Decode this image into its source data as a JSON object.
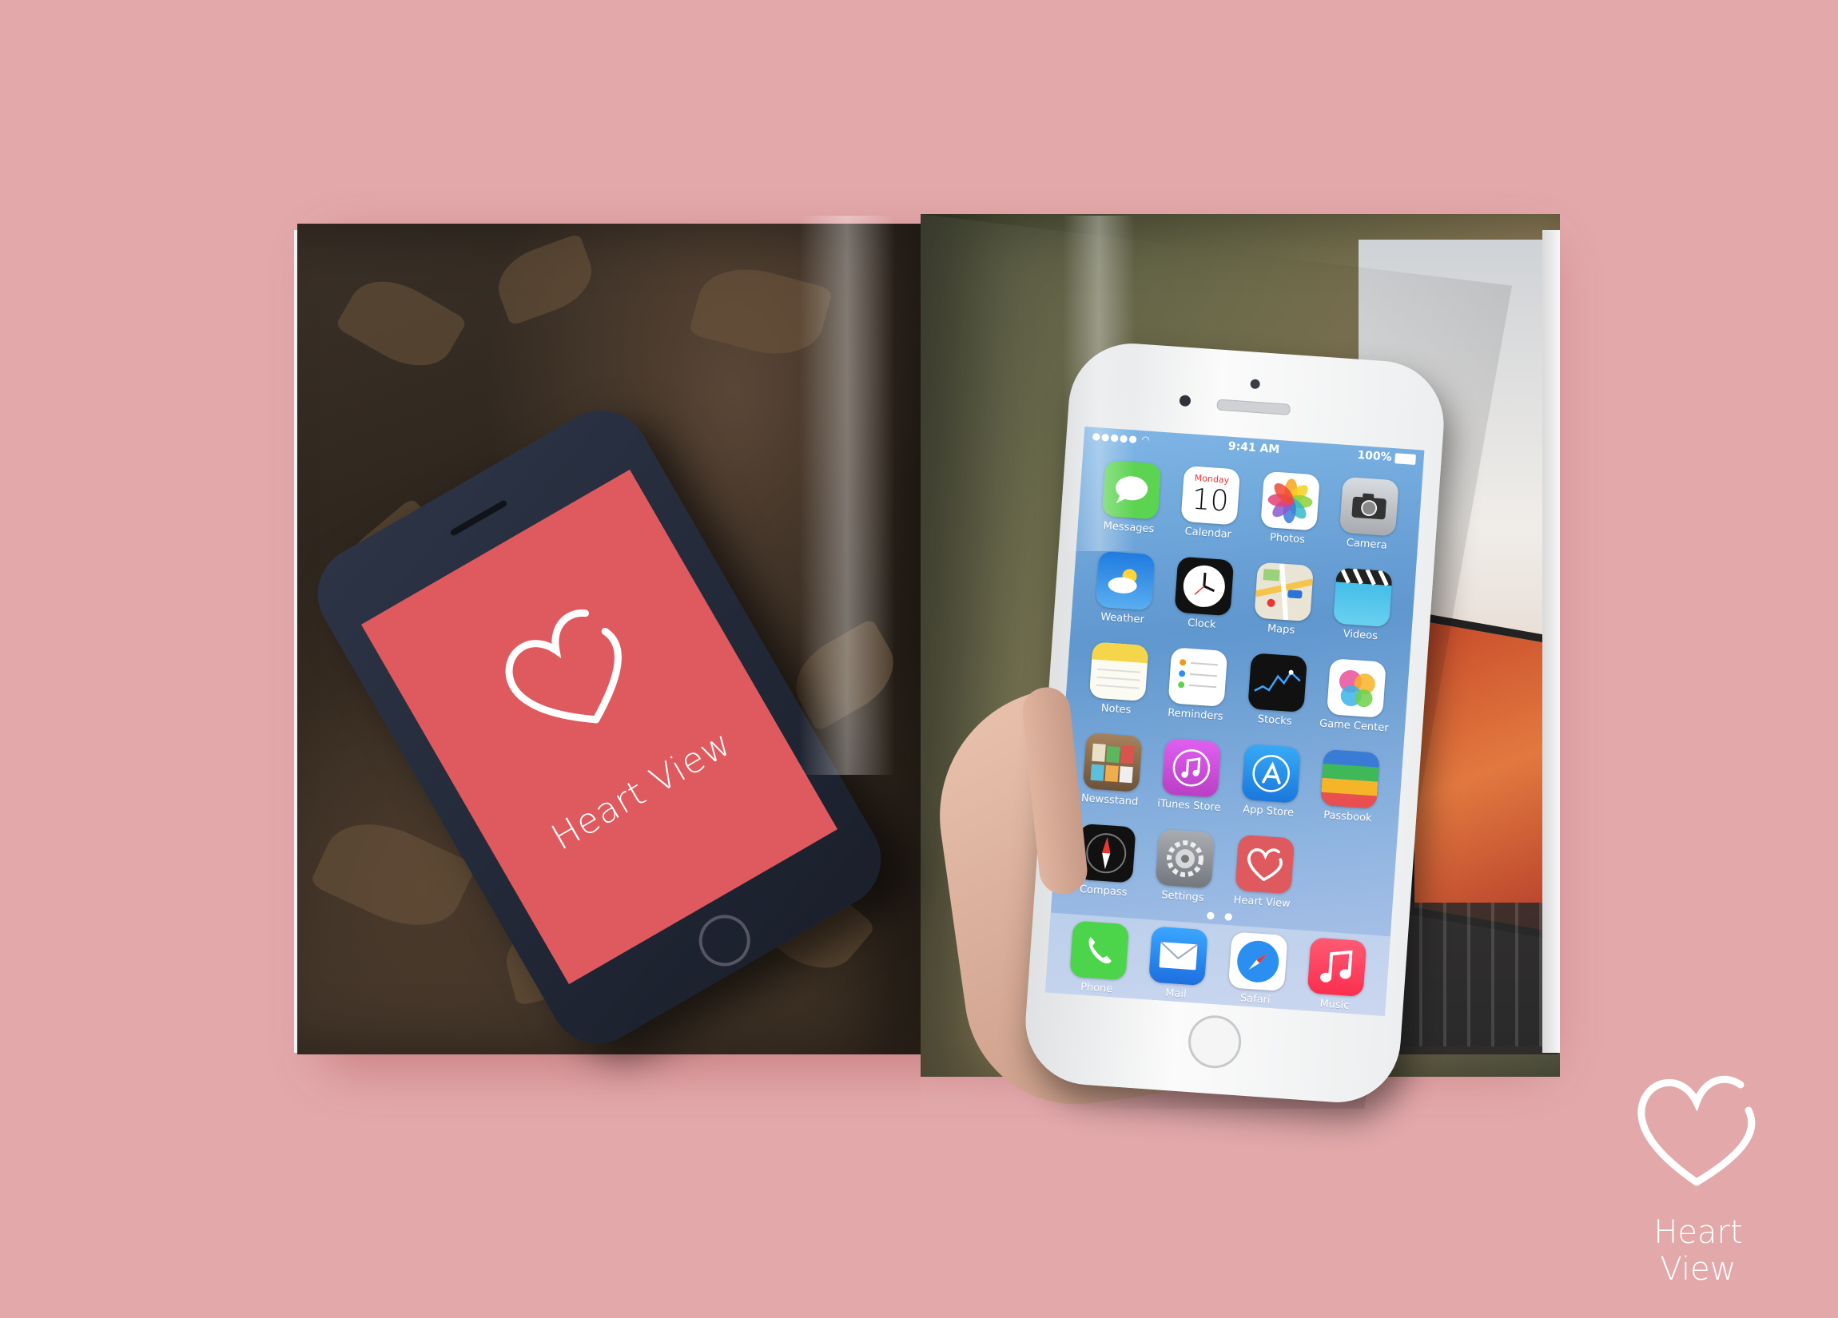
{
  "brand": {
    "name": "Heart View",
    "accent_color": "#df5a5e",
    "background_color": "#e2a8aa"
  },
  "phone_screen": {
    "status": {
      "time": "9:41 AM",
      "battery": "100%"
    },
    "apps": [
      {
        "label": "Messages",
        "icon": "speech-bubble-icon",
        "color": "#5cd452"
      },
      {
        "label": "Calendar",
        "icon": "calendar-icon",
        "color": "#ffffff",
        "day_name": "Monday",
        "day_number": "10"
      },
      {
        "label": "Photos",
        "icon": "flower-icon",
        "color": "#ffffff"
      },
      {
        "label": "Camera",
        "icon": "camera-icon",
        "color": "#bfc3c8"
      },
      {
        "label": "Weather",
        "icon": "cloud-sun-icon",
        "color": "#3a8ee6"
      },
      {
        "label": "Clock",
        "icon": "clock-icon",
        "color": "#111111"
      },
      {
        "label": "Maps",
        "icon": "map-icon",
        "color": "#e9e4d4"
      },
      {
        "label": "Videos",
        "icon": "clapperboard-icon",
        "color": "#37b8e6"
      },
      {
        "label": "Notes",
        "icon": "notepad-icon",
        "color": "#f5d64a"
      },
      {
        "label": "Reminders",
        "icon": "checklist-icon",
        "color": "#ffffff"
      },
      {
        "label": "Stocks",
        "icon": "stock-chart-icon",
        "color": "#111111"
      },
      {
        "label": "Game Center",
        "icon": "bubbles-icon",
        "color": "#ffffff"
      },
      {
        "label": "Newsstand",
        "icon": "magazine-shelf-icon",
        "color": "#8a6a4a"
      },
      {
        "label": "iTunes Store",
        "icon": "music-note-icon",
        "color": "#d94fd0"
      },
      {
        "label": "App Store",
        "icon": "app-store-icon",
        "color": "#2b8fe8"
      },
      {
        "label": "Passbook",
        "icon": "wallet-icon",
        "color": "#3fb85a"
      },
      {
        "label": "Compass",
        "icon": "compass-icon",
        "color": "#111111"
      },
      {
        "label": "Settings",
        "icon": "gear-icon",
        "color": "#8e9399"
      },
      {
        "label": "Heart View",
        "icon": "heart-icon",
        "color": "#df5a5e"
      }
    ],
    "dock": [
      {
        "label": "Phone",
        "icon": "phone-icon",
        "color": "#4cd44a"
      },
      {
        "label": "Mail",
        "icon": "envelope-icon",
        "color": "#2a8ff0"
      },
      {
        "label": "Safari",
        "icon": "compass-needle-icon",
        "color": "#2a8ff0"
      },
      {
        "label": "Music",
        "icon": "music-note-icon",
        "color": "#fc3d5c"
      }
    ]
  }
}
